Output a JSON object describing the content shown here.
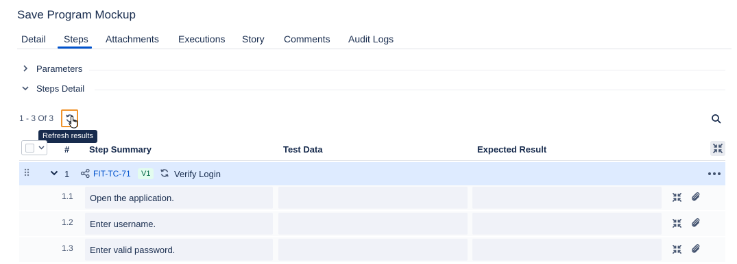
{
  "page": {
    "title": "Save Program Mockup"
  },
  "tabs": [
    {
      "label": "Detail"
    },
    {
      "label": "Steps",
      "active": true
    },
    {
      "label": "Attachments"
    },
    {
      "label": "Executions"
    },
    {
      "label": "Story"
    },
    {
      "label": "Comments"
    },
    {
      "label": "Audit Logs"
    }
  ],
  "sections": {
    "parameters": {
      "label": "Parameters",
      "expanded": false
    },
    "steps_detail": {
      "label": "Steps Detail",
      "expanded": true
    }
  },
  "pager": {
    "text": "1 - 3 Of 3"
  },
  "tooltip": {
    "text": "Refresh results"
  },
  "table": {
    "columns": {
      "num": "#",
      "summary": "Step Summary",
      "data": "Test Data",
      "expected": "Expected Result"
    },
    "parent": {
      "number": "1",
      "key": "FIT-TC-71",
      "version": "V1",
      "title": "Verify Login"
    },
    "steps": [
      {
        "number": "1.1",
        "summary": "Open the application.",
        "data": "",
        "expected": ""
      },
      {
        "number": "1.2",
        "summary": "Enter username.",
        "data": "",
        "expected": ""
      },
      {
        "number": "1.3",
        "summary": "Enter valid password.",
        "data": "",
        "expected": ""
      }
    ]
  },
  "colors": {
    "accent": "#0052cc",
    "row_highlight": "#deebff",
    "focus_ring": "#f0932b",
    "badge_bg": "#e3fcef"
  },
  "icons": [
    "chevron-right-icon",
    "chevron-down-icon",
    "refresh-icon",
    "pointer-cursor-icon",
    "search-icon",
    "collapse-icon",
    "drag-handle-icon",
    "link-icon",
    "sync-icon",
    "more-icon",
    "attachment-icon"
  ]
}
